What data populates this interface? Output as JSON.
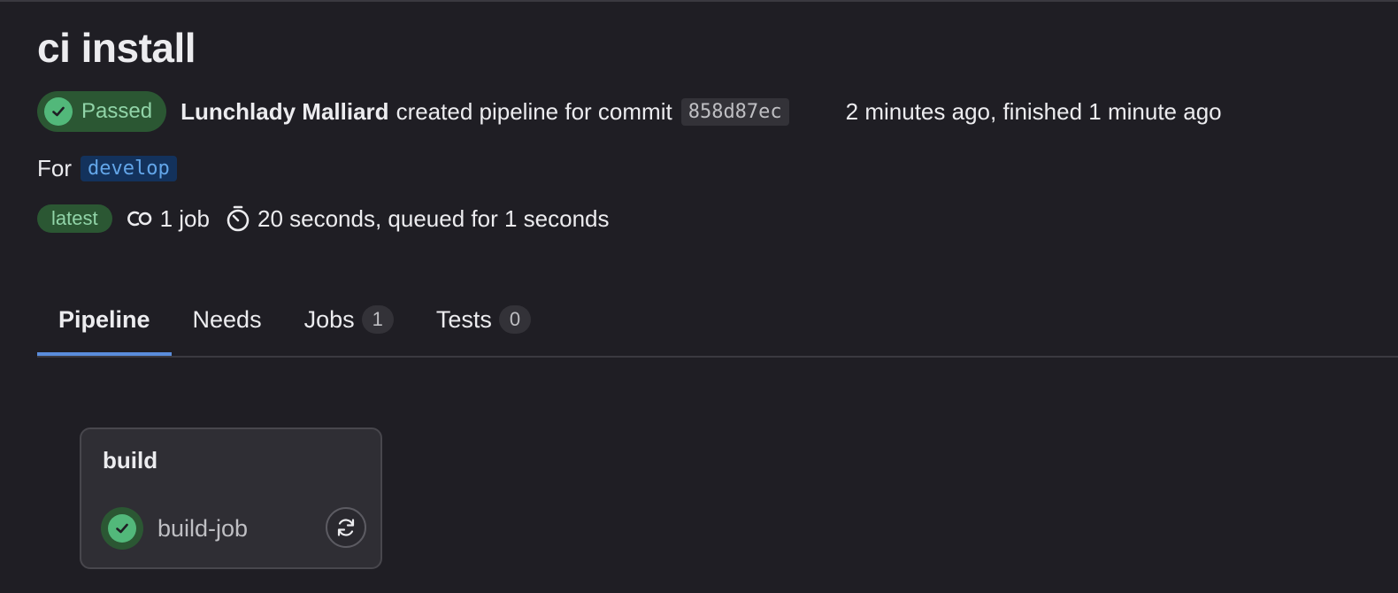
{
  "pipeline": {
    "title": "ci install",
    "status": "Passed",
    "author": "Lunchlady Malliard",
    "created_text": "created pipeline for commit",
    "commit_sha": "858d87ec",
    "time_text": "2 minutes ago, finished 1 minute ago",
    "for_label": "For",
    "branch": "develop",
    "latest_badge": "latest",
    "jobs_count_text": "1 job",
    "duration_text": "20 seconds, queued for 1 seconds"
  },
  "tabs": [
    {
      "label": "Pipeline",
      "active": true
    },
    {
      "label": "Needs"
    },
    {
      "label": "Jobs",
      "count": "1"
    },
    {
      "label": "Tests",
      "count": "0"
    }
  ],
  "stages": [
    {
      "name": "build",
      "jobs": [
        {
          "name": "build-job",
          "status": "passed",
          "action_icon": "retry-icon"
        }
      ]
    }
  ],
  "colors": {
    "background": "#1f1e24",
    "success_bg": "#2b5733",
    "success_fg": "#91d4a8",
    "success_icon": "#52b87a",
    "branch_bg": "#13325c",
    "branch_fg": "#63a6e9",
    "tab_active_border": "#5a8ddc"
  }
}
